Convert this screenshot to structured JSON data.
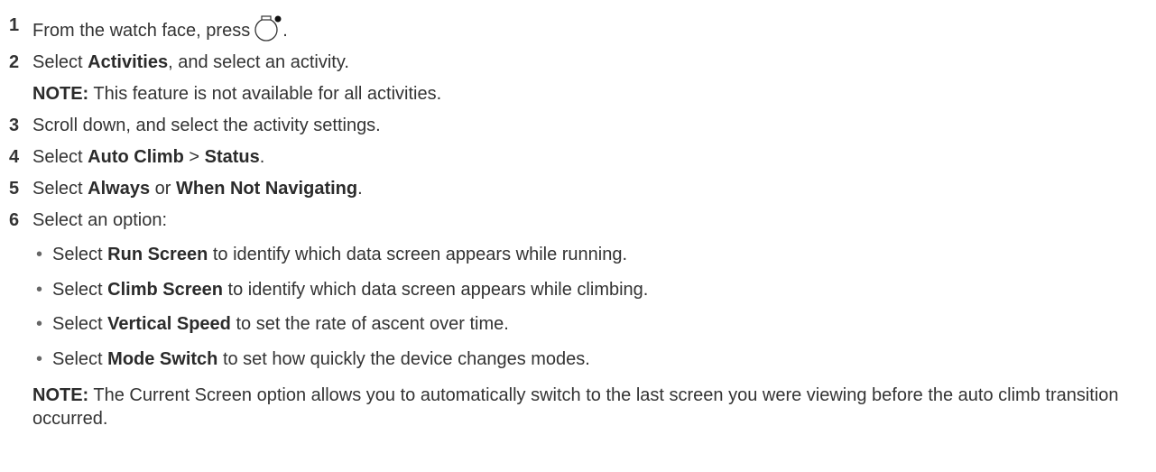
{
  "steps": [
    {
      "num": "1",
      "text_a": "From the watch face, press",
      "text_b": "."
    },
    {
      "num": "2",
      "pre": "Select ",
      "bold": "Activities",
      "post": ", and select an activity."
    },
    {
      "note_label": "NOTE:",
      "note_text": " This feature is not available for all activities."
    },
    {
      "num": "3",
      "text": "Scroll down, and select the activity settings."
    },
    {
      "num": "4",
      "pre": "Select ",
      "bold1": "Auto Climb",
      "mid": " > ",
      "bold2": "Status",
      "post": "."
    },
    {
      "num": "5",
      "pre": "Select ",
      "bold1": "Always",
      "mid": " or ",
      "bold2": "When Not Navigating",
      "post": "."
    },
    {
      "num": "6",
      "text": "Select an option:"
    }
  ],
  "bullets": [
    {
      "symbol": "•",
      "pre": "Select ",
      "bold": "Run Screen",
      "post": " to identify which data screen appears while running."
    },
    {
      "symbol": "•",
      "pre": "Select ",
      "bold": "Climb Screen",
      "post": " to identify which data screen appears while climbing."
    },
    {
      "symbol": "•",
      "pre": "Select ",
      "bold": "Vertical Speed",
      "post": " to set the rate of ascent over time."
    },
    {
      "symbol": "•",
      "pre": "Select ",
      "bold": "Mode Switch",
      "post": " to set how quickly the device changes modes."
    }
  ],
  "final_note": {
    "label": "NOTE:",
    "text": " The Current Screen option allows you to automatically switch to the last screen you were viewing before the auto climb transition occurred."
  },
  "icons": {
    "button": "watch-button-icon"
  }
}
